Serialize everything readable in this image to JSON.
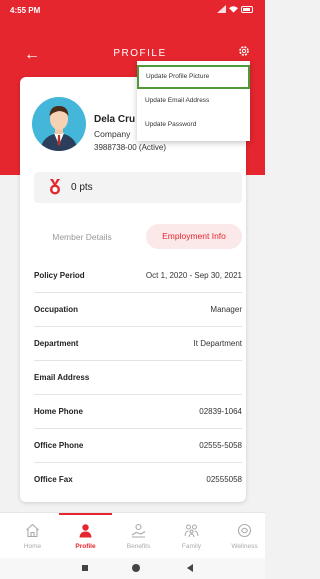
{
  "status_bar": {
    "time": "4:55 PM"
  },
  "header": {
    "back_icon": "back-arrow-icon",
    "title": "PROFILE",
    "settings_icon": "gear-icon"
  },
  "profile": {
    "name": "Dela Cru",
    "company": "Company",
    "member_no": "3988738-00 (Active)"
  },
  "points": {
    "icon": "medal-icon",
    "label": "0 pts"
  },
  "tabs": [
    {
      "label": "Member Details",
      "active": false
    },
    {
      "label": "Employment Info",
      "active": true
    }
  ],
  "employment_info": [
    {
      "label": "Policy Period",
      "value": "Oct 1, 2020 - Sep 30, 2021"
    },
    {
      "label": "Occupation",
      "value": "Manager"
    },
    {
      "label": "Department",
      "value": "It Department"
    },
    {
      "label": "Email Address",
      "value": ""
    },
    {
      "label": "Home Phone",
      "value": "02839-1064"
    },
    {
      "label": "Office Phone",
      "value": "02555-5058"
    },
    {
      "label": "Office Fax",
      "value": "02555058"
    }
  ],
  "dropdown_menu": [
    {
      "label": "Update Profile Picture",
      "highlighted": true
    },
    {
      "label": "Update Email Address",
      "highlighted": false
    },
    {
      "label": "Update Password",
      "highlighted": false
    }
  ],
  "bottom_nav": [
    {
      "label": "Home",
      "icon": "home-icon",
      "active": false
    },
    {
      "label": "Profile",
      "icon": "profile-icon",
      "active": true
    },
    {
      "label": "Benefits",
      "icon": "benefits-icon",
      "active": false
    },
    {
      "label": "Family",
      "icon": "family-icon",
      "active": false
    },
    {
      "label": "Wellness",
      "icon": "wellness-icon",
      "active": false
    }
  ],
  "colors": {
    "brand": "#e5262e",
    "highlight_border": "#4e9a3a"
  }
}
